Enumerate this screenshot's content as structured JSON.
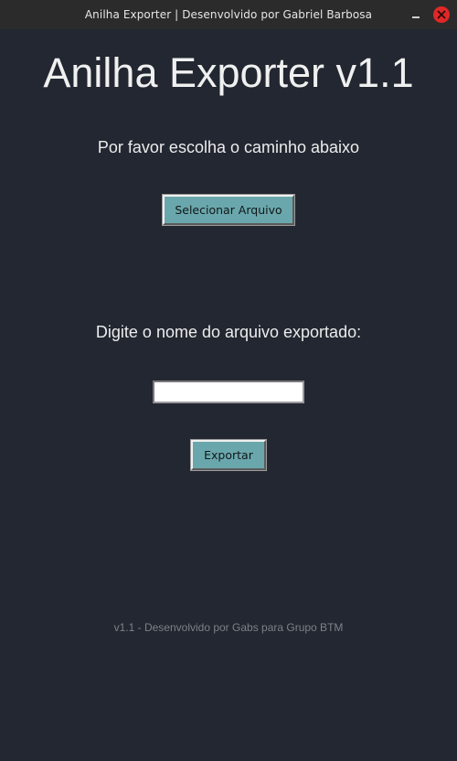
{
  "window": {
    "title": "Anilha Exporter | Desenvolvido por Gabriel Barbosa"
  },
  "main": {
    "app_title": "Anilha Exporter v1.1",
    "instruction": "Por favor escolha o caminho abaixo",
    "select_file_label": "Selecionar Arquivo",
    "filename_prompt": "Digite o nome do arquivo exportado:",
    "filename_value": "",
    "filename_placeholder": "",
    "export_label": "Exportar"
  },
  "footer": {
    "text": "v1.1 - Desenvolvido por Gabs para Grupo BTM"
  },
  "colors": {
    "background": "#222731",
    "button": "#6aa7ac",
    "close_button": "#e02727"
  }
}
